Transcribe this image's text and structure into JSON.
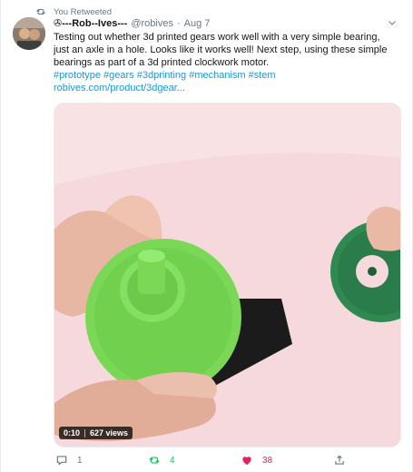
{
  "retweet": {
    "label": "You Retweeted",
    "icon": "retweet-icon"
  },
  "author": {
    "display_name": "✇---Rob--Ives---",
    "handle": "@robives",
    "separator": "·",
    "date": "Aug 7"
  },
  "tweet": {
    "lines": [
      "Testing out whether 3d printed gears work well with a very simple bearing,",
      "just an axle in a hole. Looks like it works well! Next step, using these simple",
      "bearings as part of a 3d printed clockwork motor."
    ],
    "hashtags": "#prototype #gears #3dprinting #mechanism #stem",
    "url": "robives.com/product/3dgear..."
  },
  "media": {
    "time": "0:10",
    "views": "627 views"
  },
  "actions": {
    "reply": {
      "icon": "reply-icon",
      "count": "1"
    },
    "retweet": {
      "icon": "retweet-icon",
      "count": "4"
    },
    "like": {
      "icon": "heart-icon",
      "count": "38"
    },
    "share": {
      "icon": "share-icon"
    }
  },
  "colors": {
    "link": "#1b95e0",
    "retweet": "#17bf63",
    "like": "#e0245e",
    "muted": "#657786",
    "gear": "#7bd857",
    "gear_dark": "#2f8a52",
    "bg": "#f5d9dc"
  }
}
